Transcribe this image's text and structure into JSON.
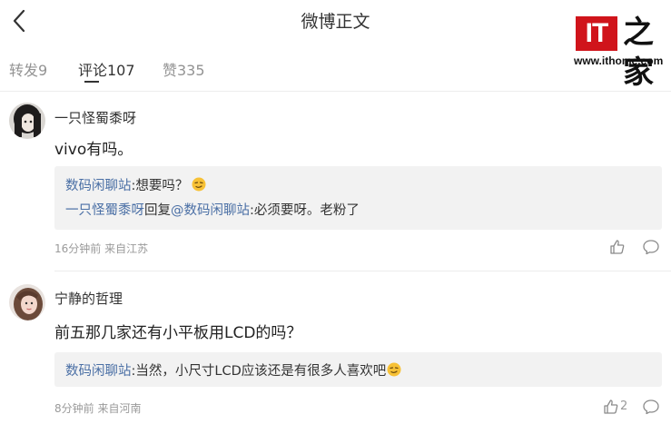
{
  "header": {
    "title": "微博正文",
    "back_icon": "chevron-left-icon"
  },
  "watermark": {
    "logo_text": "IT之家",
    "url": "www.ithome.com"
  },
  "tabs": [
    {
      "label": "转发9",
      "active": false
    },
    {
      "label": "评论107",
      "active": true
    },
    {
      "label": "赞335",
      "active": false
    }
  ],
  "comments": [
    {
      "username": "一只怪蜀黍呀",
      "text": "vivo有吗。",
      "replies": [
        {
          "from": "数码闲聊站",
          "text": ":想要吗？",
          "emoji": "smirk-emoji"
        },
        {
          "from": "一只怪蜀黍呀",
          "mid": "回复",
          "to": "@数码闲聊站",
          "text": ":必须要呀。老粉了"
        }
      ],
      "meta": "16分钟前 来自江苏",
      "like_count": ""
    },
    {
      "username": "宁静的哲理",
      "text": "前五那几家还有小平板用LCD的吗？",
      "replies": [
        {
          "from": "数码闲聊站",
          "text": ":当然，小尺寸LCD应该还是有很多人喜欢吧",
          "emoji": "smirk-emoji"
        }
      ],
      "meta": "8分钟前 来自河南",
      "like_count": "2"
    }
  ],
  "colors": {
    "link": "#4a6fa5",
    "reply_bg": "#f2f2f2",
    "logo_red": "#d0141b"
  }
}
